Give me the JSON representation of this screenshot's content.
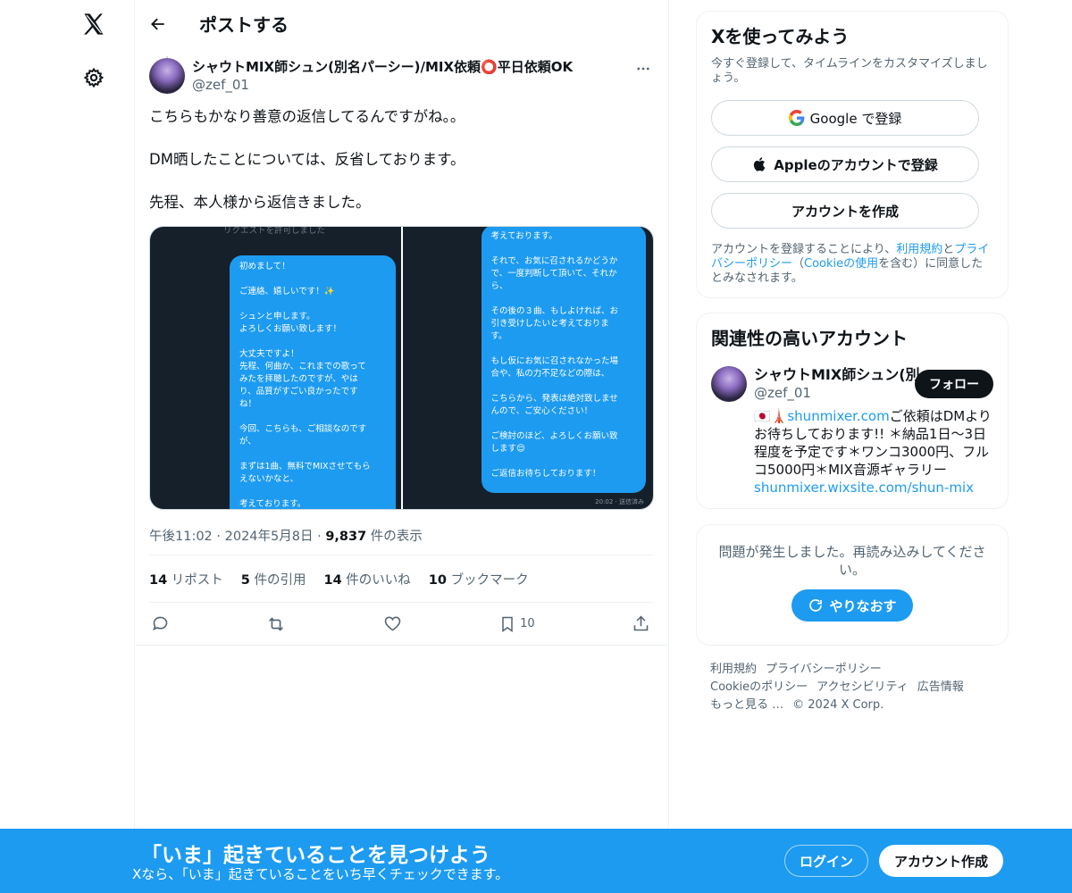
{
  "header": {
    "title": "ポストする"
  },
  "post": {
    "display_name": "シャウトMIX師シュン(別名パーシー)/MIX依頼⭕平日依頼OK",
    "handle": "@zef_01",
    "text_lines": [
      "こちらもかなり善意の返信してるんですがね。。",
      "DM晒したことについては、反省しております。",
      "先程、本人様から返信きました。"
    ],
    "media_left_faint": "リクエストを許可しました",
    "media_left_bubble": [
      "初めまして！",
      "",
      "ご連絡、嬉しいです！✨",
      "",
      "シュンと申します。",
      "よろしくお願い致します！",
      "",
      "大丈夫ですよ！",
      "先程、何曲か、これまでの歌って",
      "みたを拝聴したのですが、やは",
      "り、品質がすごい良かったです",
      "ね！",
      "",
      "今回、こちらも、ご相談なのです",
      "が、",
      "",
      "まずは1曲、無料でMIXさせてもら",
      "えないかなと、",
      "",
      "考えております。"
    ],
    "media_right_bubble": [
      "考えております。",
      "",
      "それで、お気に召されるかどうか",
      "で、一度判断して頂いて、それか",
      "ら、",
      "",
      "その後の３曲、もしよければ、お",
      "引き受けしたいと考えておりま",
      "す。",
      "",
      "もし仮にお気に召されなかった場",
      "合や、私の力不足などの際は、",
      "",
      "こちらから、発表は絶対致しませ",
      "んので、ご安心ください！",
      "",
      "ご検討のほど、よろしくお願い致",
      "します😌",
      "",
      "ご返信お待ちしております！"
    ],
    "media_right_stamp": "20:02 · 送信済み",
    "time": "午後11:02",
    "date": "2024年5月8日",
    "views_count": "9,837",
    "views_label": "件の表示",
    "stats": [
      {
        "count": "14",
        "label": "リポスト"
      },
      {
        "count": "5",
        "label": "件の引用"
      },
      {
        "count": "14",
        "label": "件のいいね"
      },
      {
        "count": "10",
        "label": "ブックマーク"
      }
    ],
    "bookmark_count": "10"
  },
  "signup_card": {
    "title": "Xを使ってみよう",
    "subtitle": "今すぐ登録して、タイムラインをカスタマイズしましょう。",
    "google_label": "Google で登録",
    "apple_label": "Appleのアカウントで登録",
    "create_label": "アカウントを作成",
    "legal_1": "アカウントを登録することにより、",
    "legal_terms": "利用規約",
    "legal_2": "と",
    "legal_privacy": "プライバシーポリシー",
    "legal_3": "（",
    "legal_cookie": "Cookieの使用",
    "legal_4": "を含む）に同意したとみなされます。"
  },
  "related_card": {
    "title": "関連性の高いアカウント",
    "name": "シャウトMIX師シュン(別",
    "handle": "@zef_01",
    "follow_label": "フォロー",
    "bio_prefix": "🇯🇵🗼",
    "bio_link1": "shunmixer.com",
    "bio_mid": "ご依頼はDMよりお待ちしております!! ＊納品1日〜3日程度を予定です＊ワンコ3000円、フルコ5000円＊MIX音源ギャラリー",
    "bio_link2": "shunmixer.wixsite.com/shun-mix"
  },
  "error_card": {
    "message": "問題が発生しました。再読み込みしてください。",
    "retry_label": "やりなおす"
  },
  "footer": {
    "links": [
      "利用規約",
      "プライバシーポリシー",
      "Cookieのポリシー",
      "アクセシビリティ",
      "広告情報",
      "もっと見る …"
    ],
    "copyright": "© 2024 X Corp."
  },
  "banner": {
    "headline": "「いま」起きていることを見つけよう",
    "subline": "Xなら、「いま」起きていることをいち早くチェックできます。",
    "login_label": "ログイン",
    "signup_label": "アカウント作成"
  },
  "colors": {
    "accent": "#1d9bf0",
    "text": "#0f1419",
    "muted": "#536471"
  },
  "icons": [
    "x-logo-icon",
    "gear-icon",
    "back-arrow-icon",
    "more-icon",
    "reply-icon",
    "repost-icon",
    "like-icon",
    "bookmark-icon",
    "share-icon",
    "google-icon",
    "apple-icon",
    "refresh-icon"
  ]
}
